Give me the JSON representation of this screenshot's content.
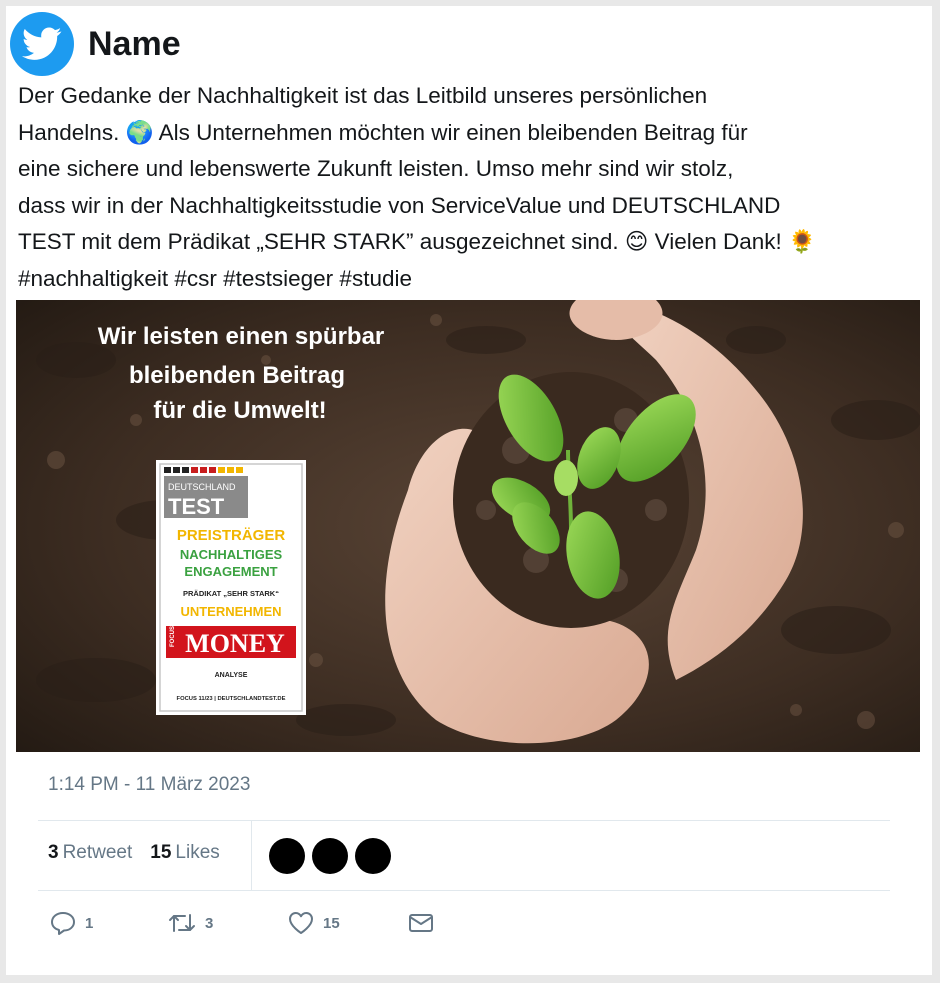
{
  "user": {
    "display_name": "Name"
  },
  "tweet": {
    "text": "Der Gedanke der Nachhaltigkeit ist das Leitbild unseres persönlichen\nHandelns. 🌍 Als Unternehmen möchten wir einen bleibenden Beitrag für\neine sichere und lebenswerte Zukunft leisten. Umso mehr sind wir stolz,\ndass wir in der Nachhaltigkeitsstudie von ServiceValue und DEUTSCHLAND\nTEST mit dem Prädikat „SEHR STARK” ausgezeichnet sind. 😊 Vielen Dank! 🌻\n#nachhaltigkeit #csr #testsieger #studie",
    "timestamp": "1:14 PM - 11 März 2023"
  },
  "media": {
    "headline_lines": [
      "Wir leisten einen spürbar",
      "bleibenden Beitrag",
      "für die Umwelt!"
    ],
    "badge": {
      "brand_top": "DEUTSCHLAND",
      "brand_bottom": "TEST",
      "line1": "PREISTRÄGER",
      "line2": "NACHHALTIGES",
      "line3": "ENGAGEMENT",
      "line4": "PRÄDIKAT „SEHR STARK“",
      "line5": "UNTERNEHMEN",
      "focus": "FOCUS",
      "money": "MONEY",
      "analyse": "ANALYSE",
      "footer": "FOCUS 11/23 | DEUTSCHLANDTEST.DE"
    }
  },
  "stats": {
    "retweets_count": "3",
    "retweets_label": "Retweet",
    "likes_count": "15",
    "likes_label": "Likes"
  },
  "actions": {
    "reply_count": "1",
    "retweet_count": "3",
    "like_count": "15"
  },
  "colors": {
    "brand": "#1d9bf0",
    "text": "#14171a",
    "muted": "#657786",
    "divider": "#e1e8ed"
  }
}
